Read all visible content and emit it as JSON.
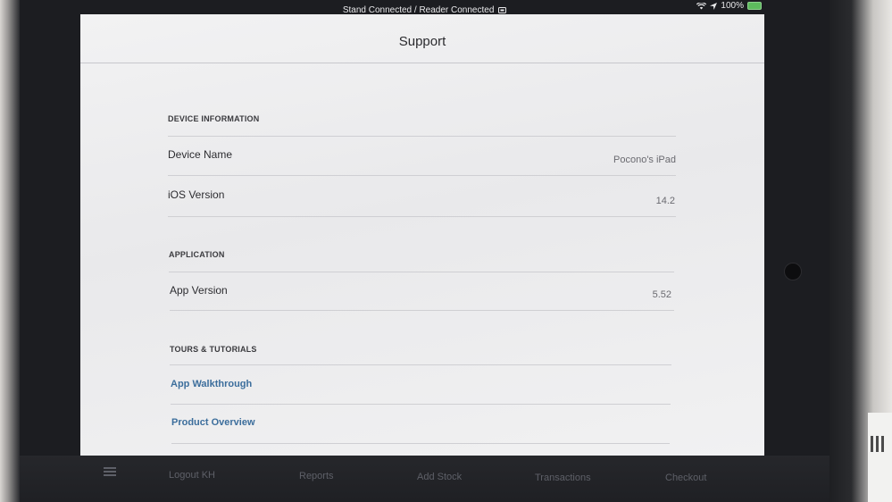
{
  "status_bar": {
    "connection_text": "Stand Connected / Reader Connected",
    "battery": "100%",
    "icons": [
      "wifi-icon",
      "location-arrow-icon",
      "battery-charging-icon"
    ]
  },
  "nav": {
    "title": "Support"
  },
  "sections": {
    "device": {
      "header": "DEVICE INFORMATION",
      "device_name_label": "Device Name",
      "device_name_value": "Pocono's iPad",
      "ios_label": "iOS Version",
      "ios_value": "14.2"
    },
    "application": {
      "header": "APPLICATION",
      "app_version_label": "App Version",
      "app_version_value": "5.52"
    },
    "tours": {
      "header": "TOURS & TUTORIALS",
      "walkthrough": "App Walkthrough",
      "overview": "Product Overview"
    }
  },
  "tabbar": {
    "menu_icon": "hamburger-menu-icon",
    "items": [
      "Logout KH",
      "Reports",
      "Add Stock",
      "Transactions",
      "Checkout"
    ]
  },
  "colors": {
    "link": "#3c6e9c",
    "screen_bg": "#f0f0f1",
    "bezel": "#1c1d21"
  }
}
